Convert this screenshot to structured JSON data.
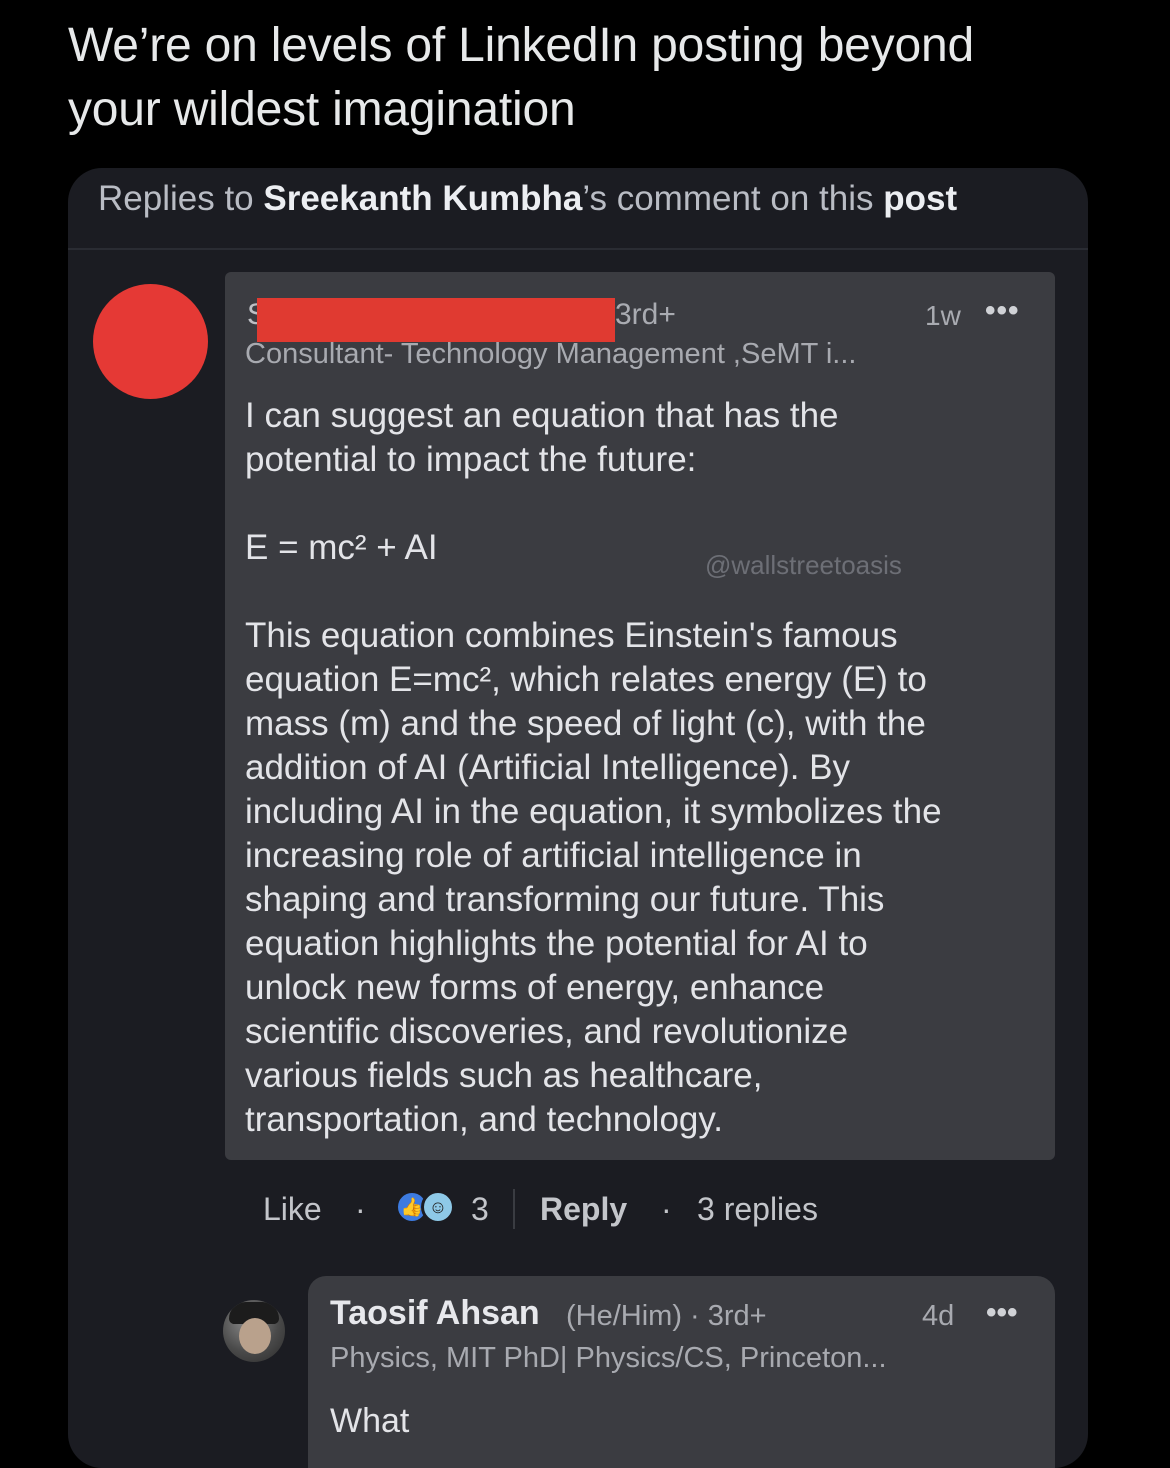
{
  "tweet": {
    "line1": "We’re on levels of LinkedIn posting beyond",
    "line2": "your wildest imagination"
  },
  "card": {
    "header_prefix": "Replies to ",
    "header_name": "Sreekanth Kumbha",
    "header_mid": "’s comment on this ",
    "header_post": "post"
  },
  "comment": {
    "author_initial": "S",
    "degree": "3rd+",
    "time": "1w",
    "more": "•••",
    "headline": "Consultant- Technology Management ,SeMT i...",
    "para1_line1": "I can suggest an equation that has the",
    "para1_line2": "potential to impact the future:",
    "equation": "E = mc² + AI",
    "para2": [
      "This equation combines Einstein's famous",
      "equation E=mc², which relates energy (E) to",
      "mass (m) and the speed of light (c), with the",
      "addition of AI (Artificial Intelligence). By",
      "including AI in the equation, it symbolizes the",
      "increasing role of artificial intelligence in",
      "shaping and transforming our future. This",
      "equation highlights the potential for AI to",
      "unlock new forms of energy, enhance",
      "scientific discoveries, and revolutionize",
      "various fields such as healthcare,",
      "transportation, and technology."
    ],
    "watermark": "@wallstreetoasis"
  },
  "actions": {
    "like": "Like",
    "dot": "·",
    "reaction_count": "3",
    "reply": "Reply",
    "replies": "3 replies"
  },
  "reply": {
    "name": "Taosif Ahsan",
    "meta": "(He/Him) · 3rd+",
    "time": "4d",
    "more": "•••",
    "headline": "Physics, MIT PhD| Physics/CS, Princeton...",
    "body": "What"
  },
  "colors": {
    "background": "#000000",
    "card": "#1b1c22",
    "comment_bg": "#3b3c41",
    "redaction": "#e03a31"
  }
}
